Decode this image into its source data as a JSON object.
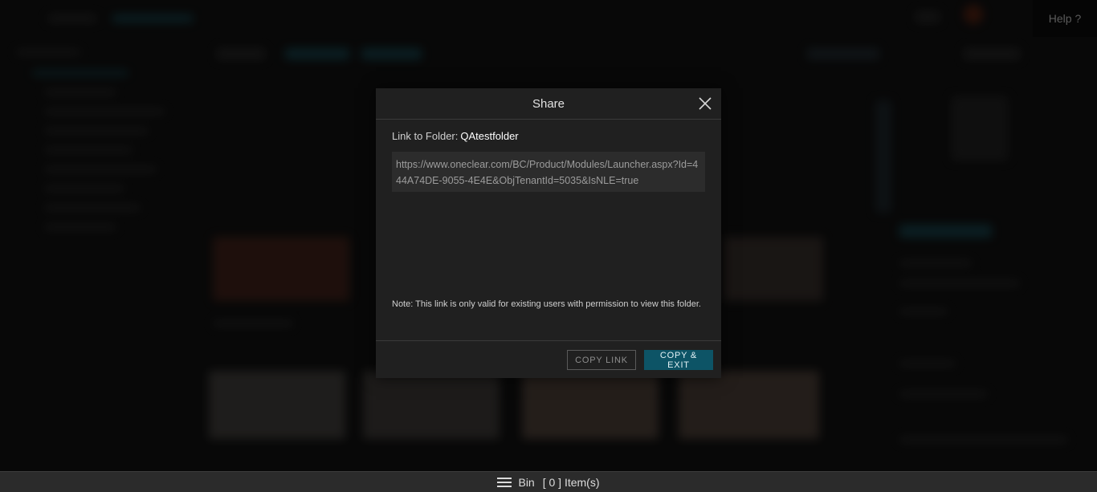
{
  "help": {
    "label": "Help ?"
  },
  "dialog": {
    "title": "Share",
    "link_prefix": "Link to Folder:",
    "folder_name": "QAtestfolder",
    "url": "https://www.oneclear.com/BC/Product/Modules/Launcher.aspx?Id=444A74DE-9055-4E4E&ObjTenantId=5035&IsNLE=true",
    "note": "Note: This link is only valid for existing users with permission to view this folder.",
    "copy_link_label": "COPY LINK",
    "copy_exit_label": "COPY & EXIT"
  },
  "bin_bar": {
    "label": "Bin",
    "count_text": "[ 0 ] Item(s)"
  },
  "colors": {
    "accent": "#0d5466",
    "dialog_bg": "#202020",
    "url_box_bg": "#2c2c2c"
  },
  "icons": {
    "close": "close-icon",
    "menu": "hamburger-menu-icon"
  }
}
